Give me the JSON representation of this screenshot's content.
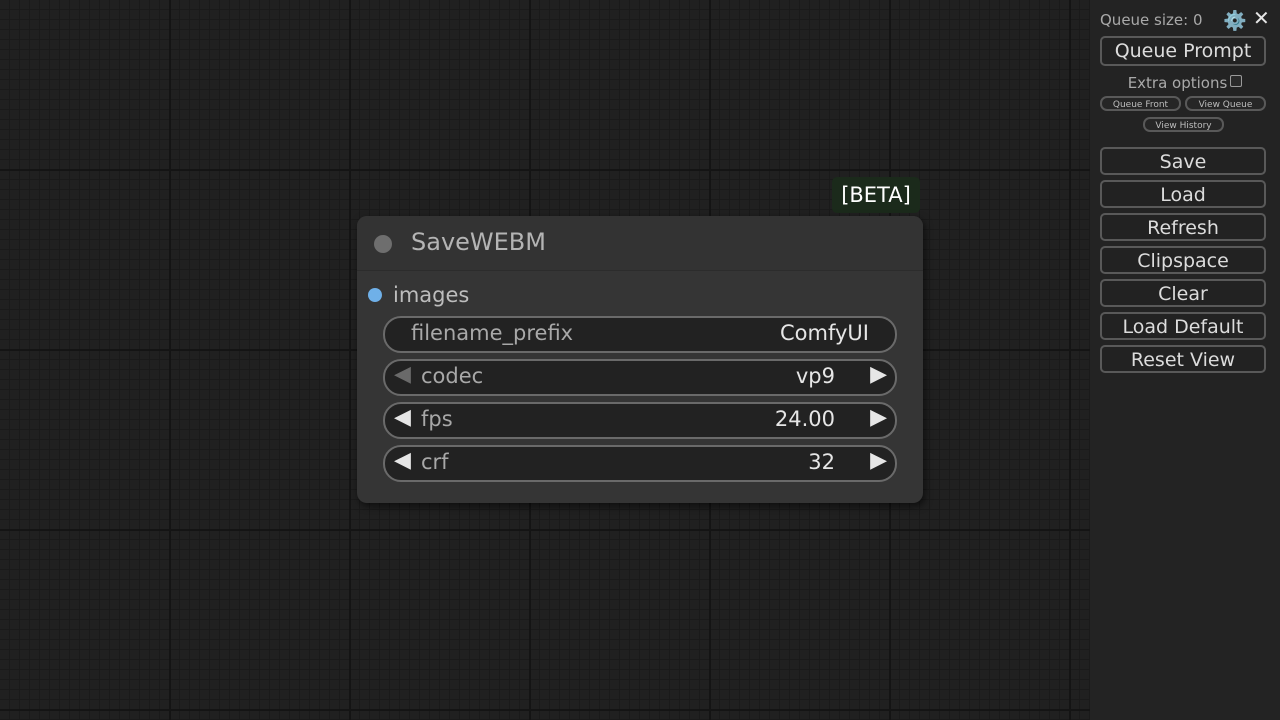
{
  "canvas": {
    "beta_badge": "[BETA]",
    "node": {
      "title": "SaveWEBM",
      "input": "images",
      "widgets": {
        "filename_prefix": {
          "name": "filename_prefix",
          "value": "ComfyUI"
        },
        "codec": {
          "name": "codec",
          "value": "vp9"
        },
        "fps": {
          "name": "fps",
          "value": "24.00"
        },
        "crf": {
          "name": "crf",
          "value": "32"
        }
      },
      "arrow_left": "◀",
      "arrow_right": "▶"
    }
  },
  "menu": {
    "queue_size": "Queue size: 0",
    "gear_icon": "⚙️",
    "close_icon": "✕",
    "queue_prompt": "Queue Prompt",
    "extra_options": "Extra options",
    "queue_front": "Queue Front",
    "view_queue": "View Queue",
    "view_history": "View History",
    "buttons": {
      "save": "Save",
      "load": "Load",
      "refresh": "Refresh",
      "clipspace": "Clipspace",
      "clear": "Clear",
      "load_default": "Load Default",
      "reset_view": "Reset View"
    }
  },
  "colors": {
    "input_slot": "#6fb0e8",
    "beta_bg": "#1b2a1b",
    "node_bg": "#353535"
  }
}
